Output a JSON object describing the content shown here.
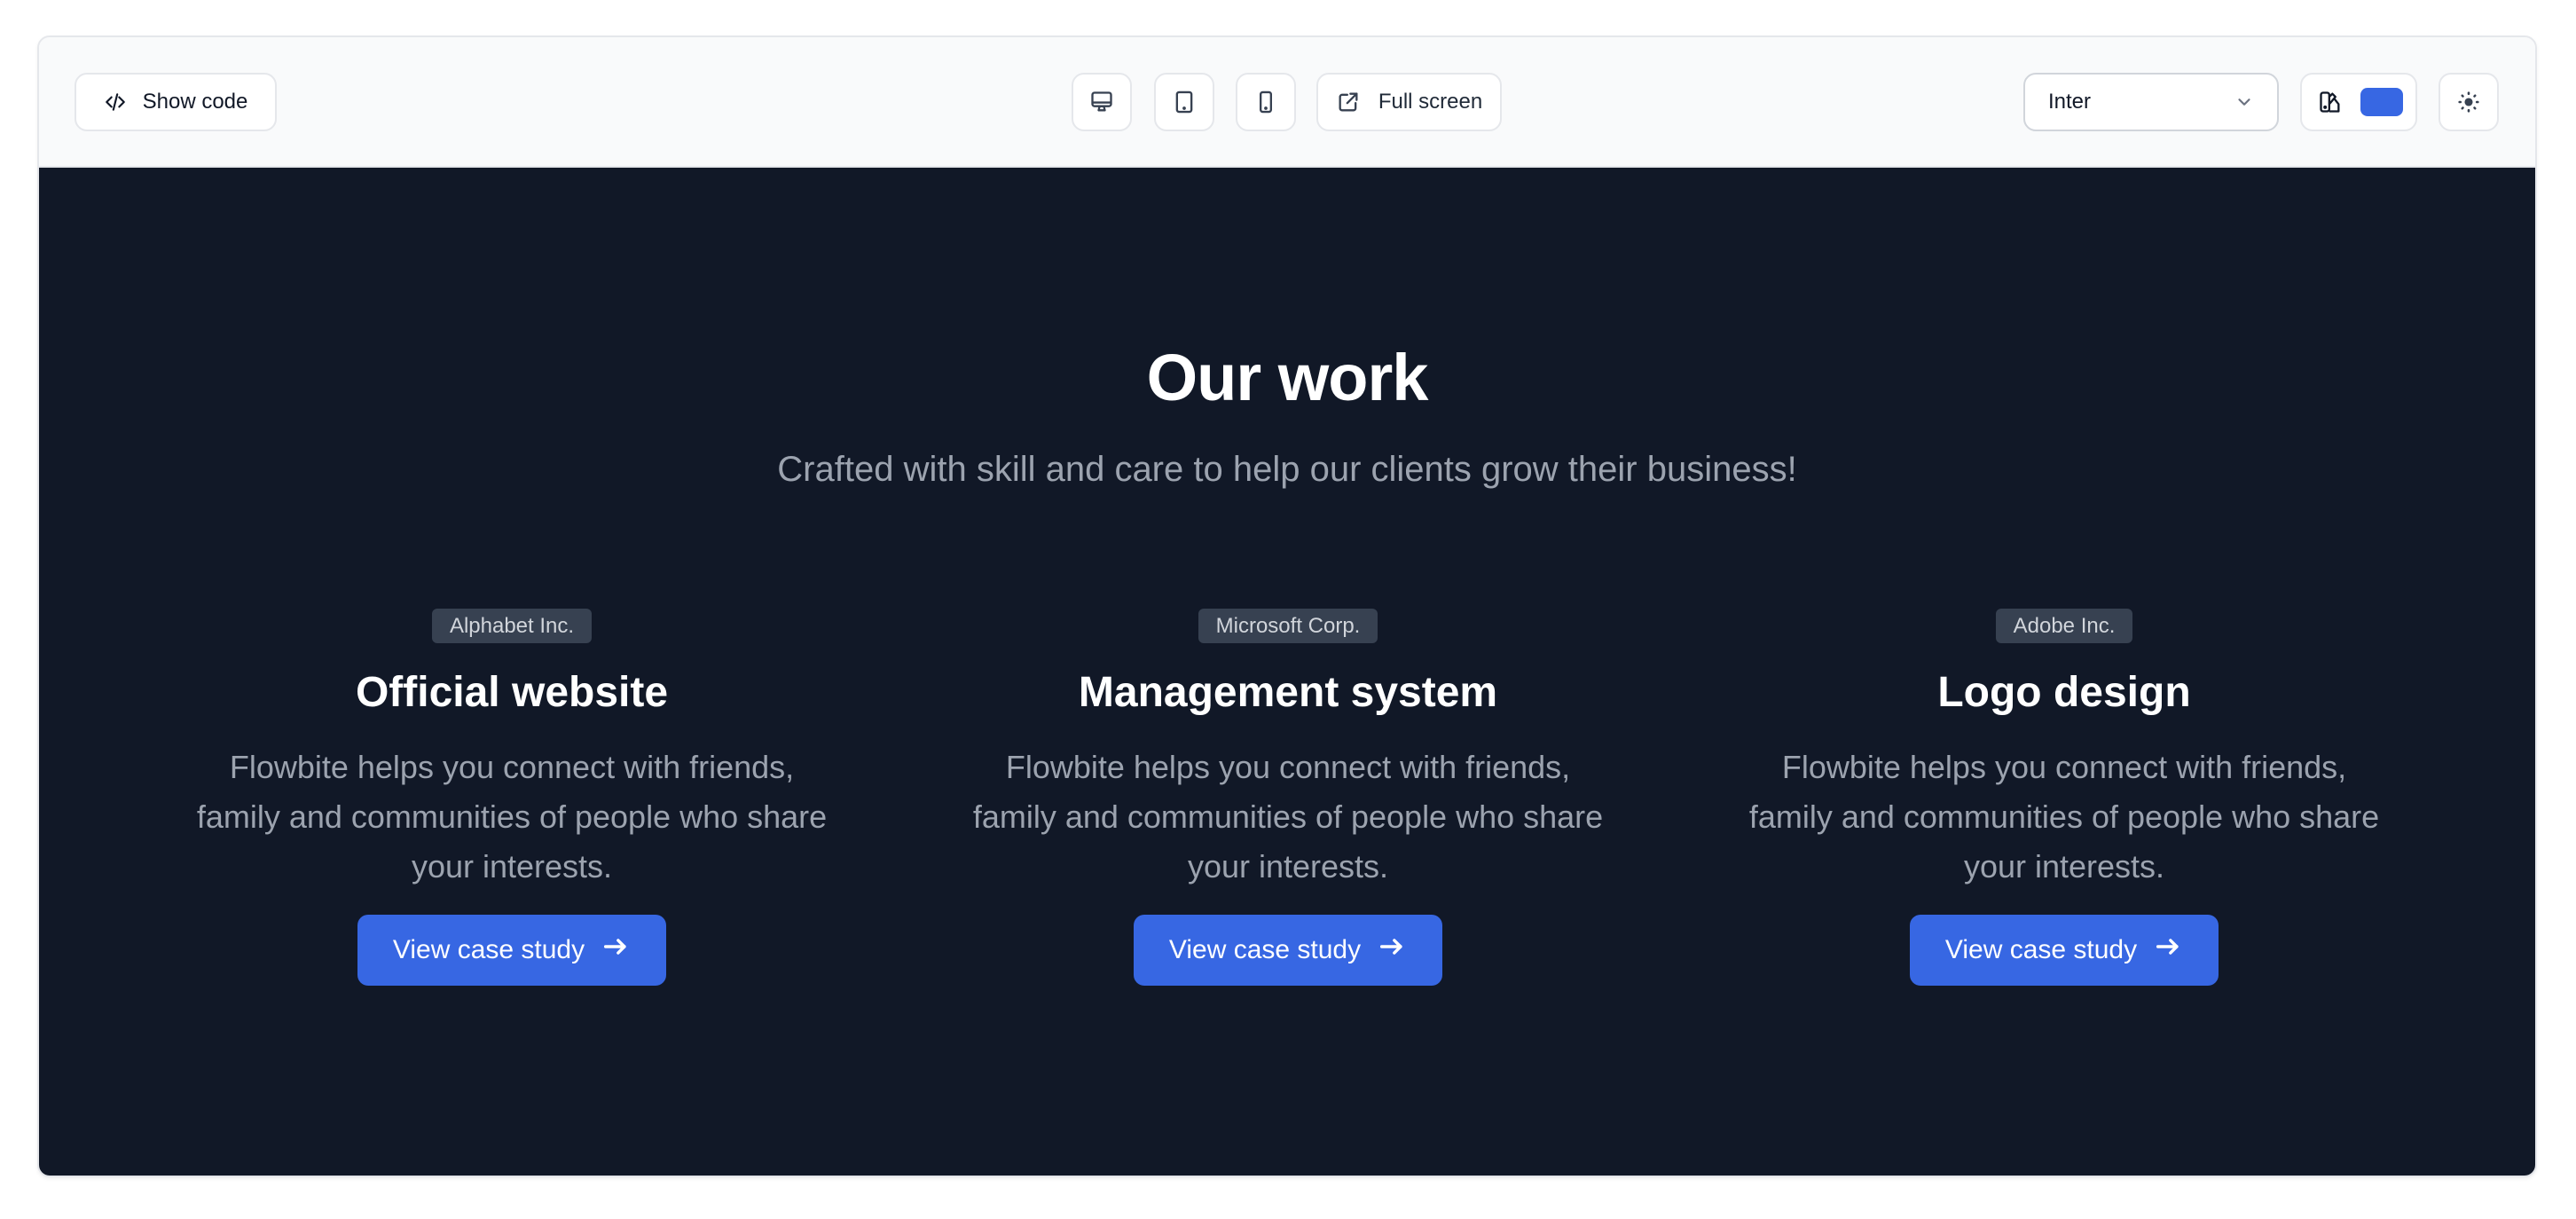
{
  "toolbar": {
    "show_code_label": "Show code",
    "full_screen_label": "Full screen",
    "font_select": {
      "value": "Inter"
    },
    "theme_color": "#3767E3",
    "icons": {
      "show_code": "code-icon",
      "desktop": "desktop-icon",
      "tablet": "tablet-icon",
      "mobile": "mobile-icon",
      "full_screen": "external-link-icon",
      "font_chevron": "chevron-down-icon",
      "palette": "palette-icon",
      "dark_mode": "sun-icon"
    }
  },
  "section": {
    "title": "Our work",
    "subtitle": "Crafted with skill and care to help our clients grow their business!",
    "cards": [
      {
        "badge": "Alphabet Inc.",
        "title": "Official website",
        "text": "Flowbite helps you connect with friends, family and communities of people who share your interests.",
        "button": "View case study"
      },
      {
        "badge": "Microsoft Corp.",
        "title": "Management system",
        "text": "Flowbite helps you connect with friends, family and communities of people who share your interests.",
        "button": "View case study"
      },
      {
        "badge": "Adobe Inc.",
        "title": "Logo design",
        "text": "Flowbite helps you connect with friends, family and communities of people who share your interests.",
        "button": "View case study"
      }
    ]
  },
  "colors": {
    "background_dark": "#111827",
    "accent": "#3767E3",
    "badge_bg": "#374151",
    "muted_text": "#9CA3AF"
  }
}
